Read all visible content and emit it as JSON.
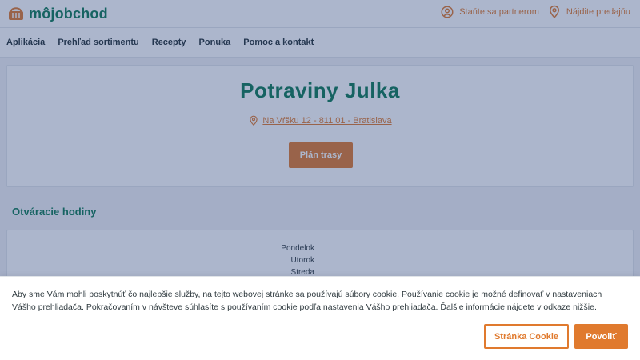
{
  "header": {
    "logo_text": "môjobchod",
    "links": [
      {
        "label": "Staňte sa partnerom",
        "icon": "user-circle-icon"
      },
      {
        "label": "Nájdite predajňu",
        "icon": "map-pin-icon"
      }
    ]
  },
  "nav": {
    "items": [
      "Aplikácia",
      "Prehľad sortimentu",
      "Recepty",
      "Ponuka",
      "Pomoc a kontakt"
    ]
  },
  "store": {
    "name": "Potraviny Julka",
    "address": "Na Vŕšku 12 - 811 01 - Bratislava",
    "route_button": "Plán trasy"
  },
  "hours": {
    "title": "Otváracie hodiny",
    "days": [
      "Pondelok",
      "Utorok",
      "Streda"
    ]
  },
  "cookie_banner": {
    "text": "Aby sme Vám mohli poskytnúť čo najlepšie služby, na tejto webovej stránke sa používajú súbory cookie. Používanie cookie je možné definovať v nastaveniach Vášho prehliadača. Pokračovaním v návšteve súhlasíte s používaním cookie podľa nastavenia Vášho prehliadača. Ďalšie informácie nájdete v odkaze nižšie.",
    "settings_button": "Stránka Cookie",
    "allow_button": "Povoliť"
  },
  "colors": {
    "brand_green": "#0d7a55",
    "accent_orange": "#e07a2e",
    "overlay": "#264078"
  }
}
